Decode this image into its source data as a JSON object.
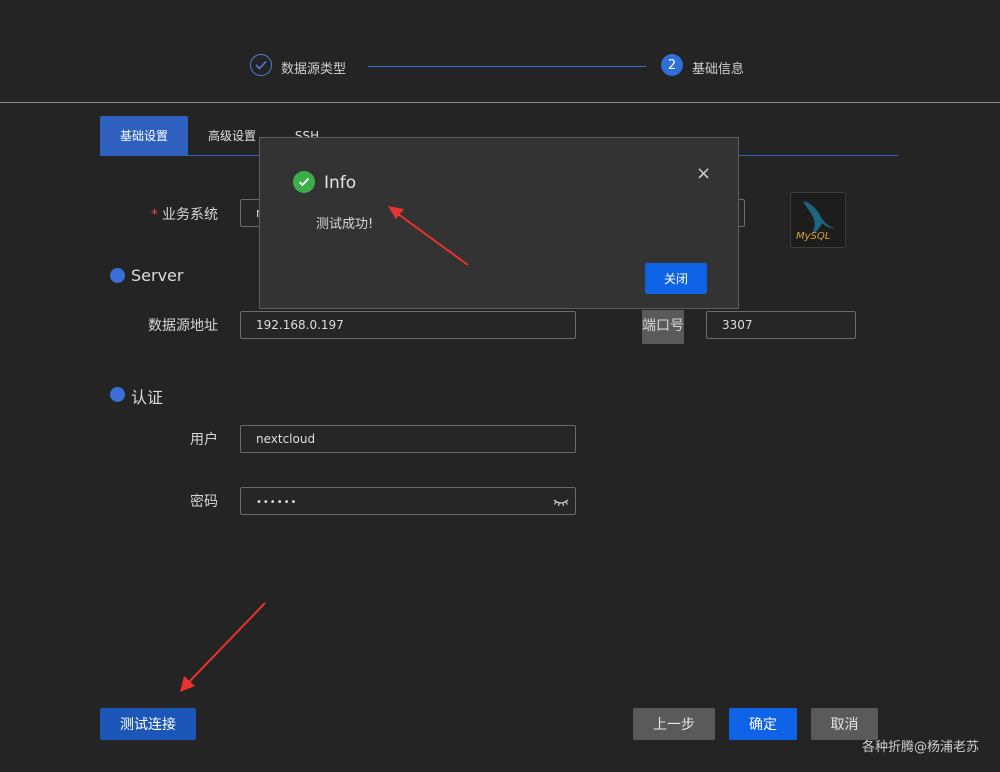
{
  "steps": [
    {
      "label": "数据源类型",
      "status": "done"
    },
    {
      "number": "2",
      "label": "基础信息",
      "status": "active"
    }
  ],
  "tabs": [
    {
      "label": "基础设置",
      "active": true
    },
    {
      "label": "高级设置",
      "active": false
    },
    {
      "label": "SSH",
      "active": false
    }
  ],
  "form": {
    "business_system": {
      "required_mark": "*",
      "label": "业务系统",
      "value": "n"
    },
    "server_section": "Server",
    "datasource_address": {
      "label": "数据源地址",
      "value": "192.168.0.197"
    },
    "port": {
      "label": "端口号",
      "value": "3307"
    },
    "auth_section": "认证",
    "user": {
      "label": "用户",
      "value": "nextcloud"
    },
    "password": {
      "label": "密码",
      "value": "••••••"
    }
  },
  "logo": {
    "text": "MySQL"
  },
  "modal": {
    "title": "Info",
    "message": "测试成功!",
    "close_label": "关闭",
    "close_icon": "×"
  },
  "footer": {
    "test_label": "测试连接",
    "prev_label": "上一步",
    "confirm_label": "确定",
    "cancel_label": "取消"
  },
  "watermark": "各种折腾@杨浦老苏",
  "colors": {
    "accent": "#2f6fd6",
    "success": "#3eae4a",
    "annotation_arrow": "#e8322e"
  }
}
